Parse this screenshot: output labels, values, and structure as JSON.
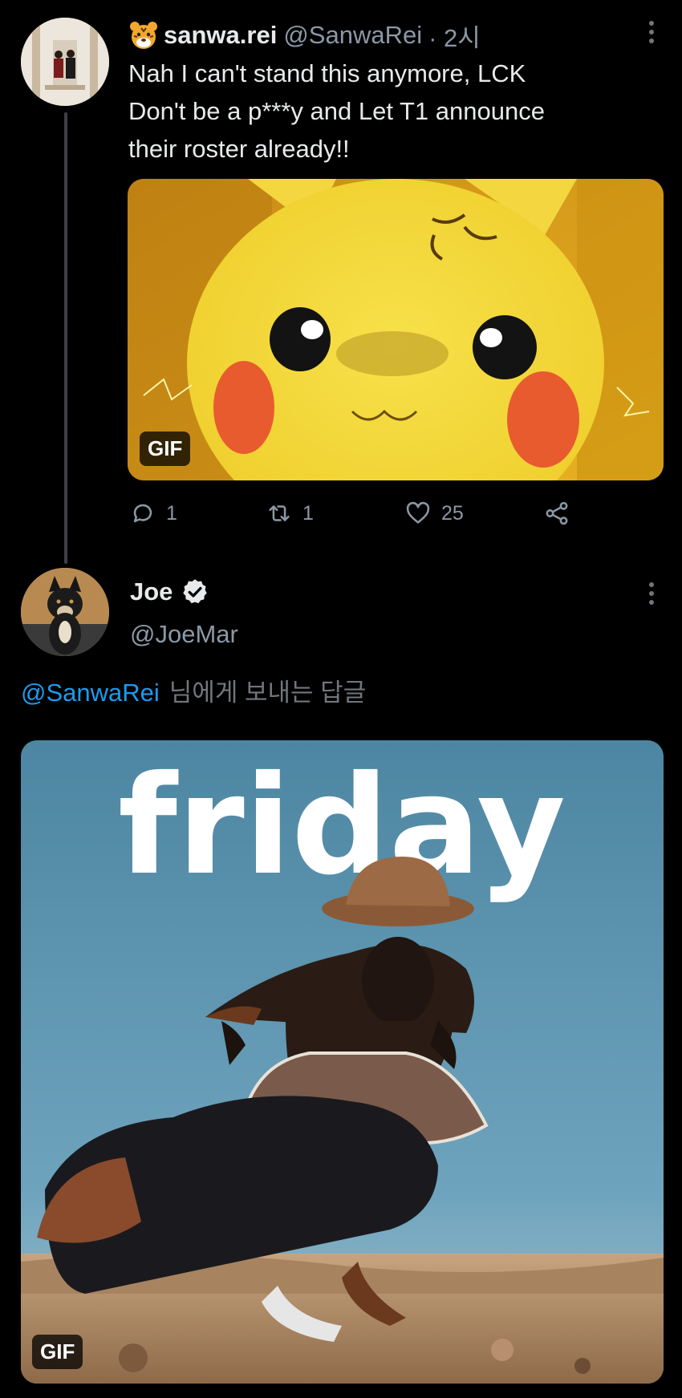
{
  "tweet1": {
    "display_name": "sanwa.rei",
    "handle": "@SanwaRei",
    "time": "· 2시",
    "emoji_icon": "tiger-face-icon",
    "text_lines": [
      "Nah I can't stand this anymore, LCK",
      "Don't be a p***y and Let T1 announce",
      "their roster already!!"
    ],
    "media_badge": "GIF",
    "actions": {
      "replies": "1",
      "retweets": "1",
      "likes": "25"
    }
  },
  "tweet2": {
    "display_name": "Joe",
    "handle": "@JoeMar",
    "verified": true,
    "reply_mention": "@SanwaRei",
    "reply_suffix": "님에게 보내는 답글",
    "media_text": "friday",
    "media_badge": "GIF"
  },
  "colors": {
    "background": "#000000",
    "text": "#e7e9ea",
    "muted": "#8b98a5",
    "link": "#1d9bf0",
    "thread_line": "#3e4144"
  }
}
